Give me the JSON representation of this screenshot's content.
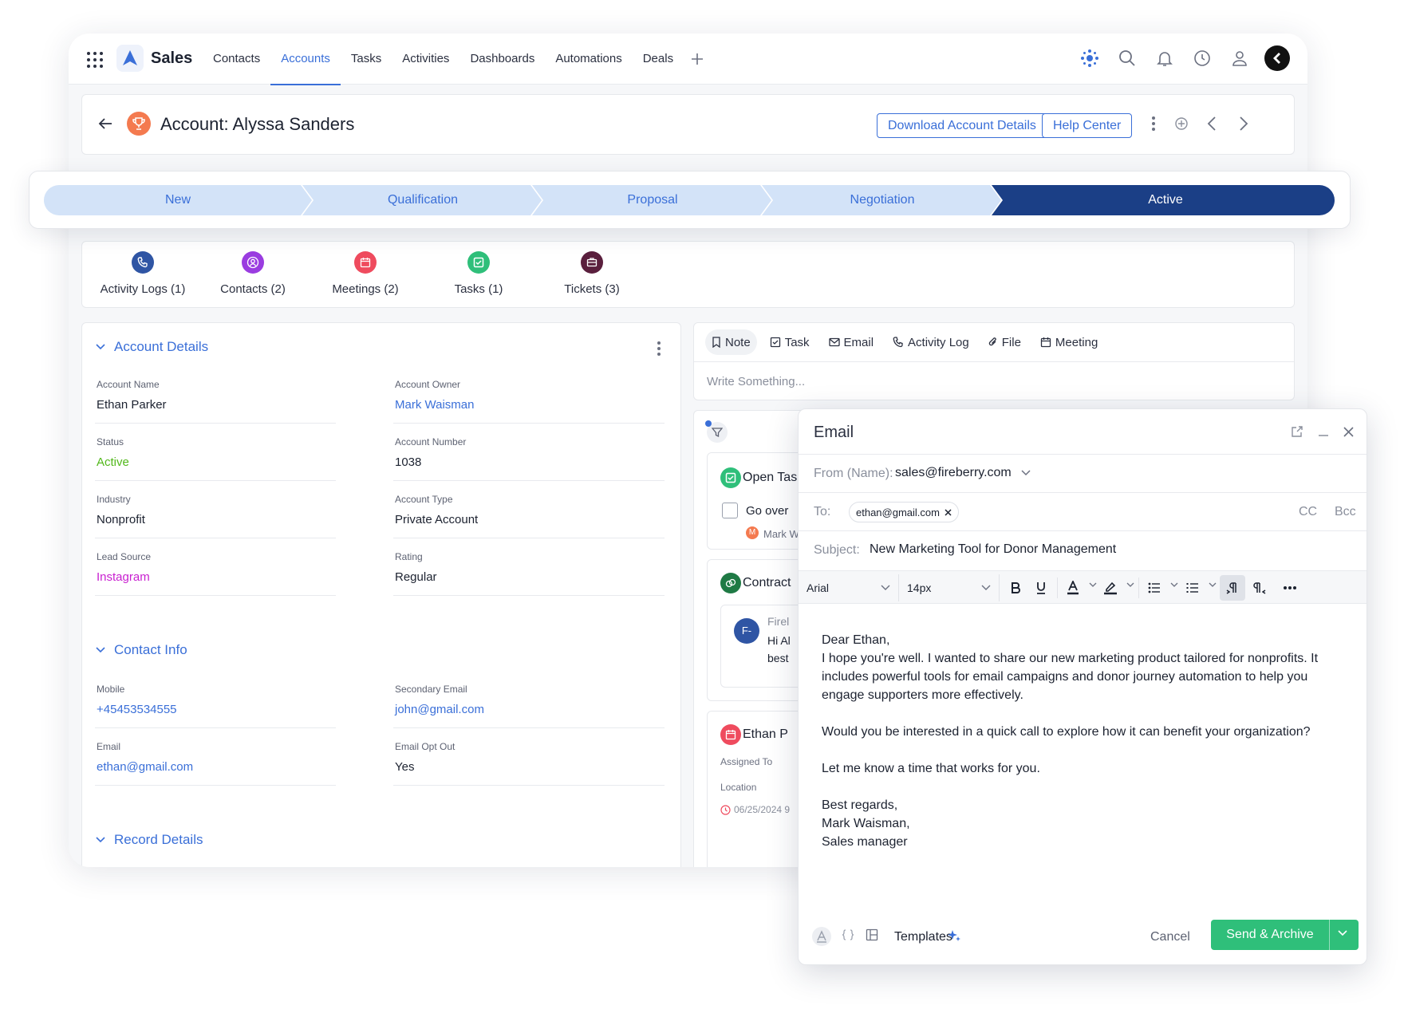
{
  "app": {
    "brand": "Sales",
    "nav": [
      "Contacts",
      "Accounts",
      "Tasks",
      "Activities",
      "Dashboards",
      "Automations",
      "Deals"
    ],
    "active_nav": "Accounts"
  },
  "header": {
    "title": "Account: Alyssa Sanders",
    "download_btn": "Download Account Details",
    "help_btn": "Help Center"
  },
  "stages": {
    "items": [
      "New",
      "Qualification",
      "Proposal",
      "Negotiation",
      "Active"
    ],
    "active": "Active",
    "colors": {
      "inactive_bg": "#d3e3f8",
      "active_bg": "#1b3f86",
      "inactive_text": "#3a6fd8"
    }
  },
  "related_tabs": [
    {
      "label": "Activity Logs (1)",
      "icon": "phone-icon",
      "color": "#2f55a4"
    },
    {
      "label": "Contacts (2)",
      "icon": "contact-icon",
      "color": "#9a3ce0"
    },
    {
      "label": "Meetings (2)",
      "icon": "calendar-icon",
      "color": "#ef4b5e"
    },
    {
      "label": "Tasks (1)",
      "icon": "check-icon",
      "color": "#2fbf7a"
    },
    {
      "label": "Tickets (3)",
      "icon": "ticket-icon",
      "color": "#5a1f3d"
    }
  ],
  "account_details": {
    "section": "Account Details",
    "fields": [
      {
        "label": "Account Name",
        "value": "Ethan Parker"
      },
      {
        "label": "Account Owner",
        "value": "Mark Waisman"
      },
      {
        "label": "Status",
        "value": "Active"
      },
      {
        "label": "Account Number",
        "value": "1038"
      },
      {
        "label": "Industry",
        "value": "Nonprofit"
      },
      {
        "label": "Account Type",
        "value": "Private Account"
      },
      {
        "label": "Lead Source",
        "value": "Instagram"
      },
      {
        "label": "Rating",
        "value": "Regular"
      }
    ]
  },
  "contact_info": {
    "section": "Contact Info",
    "fields": [
      {
        "label": "Mobile",
        "value": "+45453534555"
      },
      {
        "label": "Secondary Email",
        "value": "john@gmail.com"
      },
      {
        "label": "Email",
        "value": "ethan@gmail.com"
      },
      {
        "label": "Email Opt Out",
        "value": "Yes"
      }
    ]
  },
  "record_details": {
    "section": "Record Details"
  },
  "composer": {
    "tabs": [
      "Note",
      "Task",
      "Email",
      "Activity Log",
      "File",
      "Meeting"
    ],
    "placeholder": "Write Something..."
  },
  "timeline": {
    "open_tasks": "Open Tas",
    "task_text": "Go over",
    "task_owner": "Mark W",
    "task_owner_initial": "M",
    "contract": "Contract",
    "fb_name": "Firel",
    "fb_initials": "F-",
    "fb_line1": "Hi Al",
    "fb_line2": "best",
    "meeting": "Ethan P",
    "assigned_to": "Assigned To",
    "location": "Location",
    "date": "06/25/2024 9"
  },
  "email": {
    "title": "Email",
    "from_label": "From (Name):",
    "from_value": "sales@fireberry.com",
    "to_label": "To:",
    "to_chip": "ethan@gmail.com",
    "cc": "CC",
    "bcc": "Bcc",
    "subject_label": "Subject:",
    "subject_value": "New Marketing Tool for Donor Management",
    "font": "Arial",
    "size": "14px",
    "body": {
      "greeting": "Dear Ethan,",
      "p1": "I hope you're well. I wanted to share our new marketing product tailored for nonprofits. It includes powerful tools for email campaigns and donor journey automation to help you engage supporters more effectively.",
      "p2": "Would you be interested in a quick call to explore how it can benefit your organization?",
      "p3": "Let me know a time that works for you.",
      "sign1": "Best regards,",
      "sign2": "Mark Waisman,",
      "sign3": "Sales manager"
    },
    "templates": "Templates",
    "cancel": "Cancel",
    "send": "Send & Archive",
    "send_color": "#2fbf7a"
  }
}
